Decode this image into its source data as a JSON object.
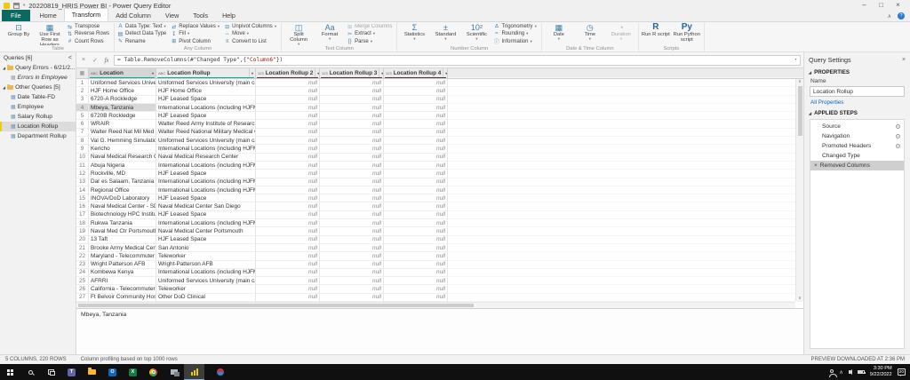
{
  "window": {
    "title": "20220819_HRIS Power BI - Power Query Editor"
  },
  "colors": {
    "accent_yellow": "#f2c80f",
    "file_tab_teal": "#0a6a62",
    "quality_valid": "#00b294",
    "quality_empty": "#5a3434",
    "link_blue": "#0a66c2",
    "string_red": "#a31515"
  },
  "ribbon": {
    "tabs": [
      {
        "label": "File",
        "style": "file"
      },
      {
        "label": "Home"
      },
      {
        "label": "Transform",
        "active": true
      },
      {
        "label": "Add Column"
      },
      {
        "label": "View"
      },
      {
        "label": "Tools"
      },
      {
        "label": "Help"
      }
    ],
    "groups": [
      {
        "label": "Table",
        "buttons": [
          {
            "label": "Group By",
            "icon": "group-by",
            "size": "big"
          },
          {
            "label": "Use First Row as Headers",
            "icon": "first-row-headers",
            "size": "big",
            "dropdown": true
          },
          {
            "label": "Transpose",
            "icon": "transpose"
          },
          {
            "label": "Reverse Rows",
            "icon": "reverse-rows"
          },
          {
            "label": "Count Rows",
            "icon": "count-rows"
          }
        ]
      },
      {
        "label": "Any Column",
        "buttons": [
          {
            "label": "Data Type: Text",
            "icon": "data-type",
            "dropdown": true
          },
          {
            "label": "Detect Data Type",
            "icon": "detect-data-type"
          },
          {
            "label": "Rename",
            "icon": "rename"
          },
          {
            "label": "Replace Values",
            "icon": "replace-values",
            "dropdown": true
          },
          {
            "label": "Fill",
            "icon": "fill",
            "dropdown": true
          },
          {
            "label": "Pivot Column",
            "icon": "pivot-column"
          },
          {
            "label": "Unpivot Columns",
            "icon": "unpivot-columns",
            "dropdown": true
          },
          {
            "label": "Move",
            "icon": "move",
            "dropdown": true
          },
          {
            "label": "Convert to List",
            "icon": "convert-to-list"
          }
        ]
      },
      {
        "label": "Text Column",
        "buttons": [
          {
            "label": "Split Column",
            "icon": "split-column",
            "size": "big",
            "dropdown": true
          },
          {
            "label": "Format",
            "icon": "format",
            "size": "big",
            "dropdown": true
          },
          {
            "label": "Merge Columns",
            "icon": "merge-columns",
            "disabled": true
          },
          {
            "label": "Extract",
            "icon": "extract",
            "dropdown": true
          },
          {
            "label": "Parse",
            "icon": "parse",
            "dropdown": true
          }
        ]
      },
      {
        "label": "Number Column",
        "buttons": [
          {
            "label": "Statistics",
            "icon": "statistics",
            "size": "big",
            "dropdown": true
          },
          {
            "label": "Standard",
            "icon": "standard",
            "size": "big",
            "dropdown": true
          },
          {
            "label": "Scientific",
            "icon": "scientific",
            "size": "big",
            "dropdown": true
          },
          {
            "label": "Trigonometry",
            "icon": "trigonometry",
            "dropdown": true
          },
          {
            "label": "Rounding",
            "icon": "rounding",
            "dropdown": true
          },
          {
            "label": "Information",
            "icon": "information",
            "dropdown": true
          }
        ]
      },
      {
        "label": "Date & Time Column",
        "buttons": [
          {
            "label": "Date",
            "icon": "date",
            "size": "big",
            "dropdown": true
          },
          {
            "label": "Time",
            "icon": "time",
            "size": "big",
            "dropdown": true
          },
          {
            "label": "Duration",
            "icon": "duration",
            "size": "big",
            "dropdown": true,
            "disabled": true
          }
        ]
      },
      {
        "label": "Scripts",
        "buttons": [
          {
            "label": "Run R script",
            "icon": "run-r",
            "size": "big"
          },
          {
            "label": "Run Python script",
            "icon": "run-python",
            "size": "big"
          }
        ]
      }
    ]
  },
  "formula_bar": {
    "fx_label": "fx",
    "parts": [
      {
        "text": "= Table.RemoveColumns(#\"Changed Type\",{",
        "c": "#3b3b3b"
      },
      {
        "text": "\"Column6\"",
        "c": "#a31515"
      },
      {
        "text": "})",
        "c": "#3b3b3b"
      }
    ]
  },
  "queries_panel": {
    "title": "Queries [6]",
    "collapse_icon": "<",
    "items": [
      {
        "label": "Query Errors - 6/21/2...",
        "type": "folder",
        "indent": 0
      },
      {
        "label": "Errors in Employee",
        "type": "error",
        "indent": 1,
        "italic": true
      },
      {
        "label": "Other Queries [5]",
        "type": "folder",
        "indent": 0
      },
      {
        "label": "Date Table-FD",
        "type": "table",
        "indent": 1
      },
      {
        "label": "Employee",
        "type": "table",
        "indent": 1
      },
      {
        "label": "Salary Rollup",
        "type": "table",
        "indent": 1
      },
      {
        "label": "Location Rollup",
        "type": "table",
        "indent": 1,
        "selected": true
      },
      {
        "label": "Department Rollup",
        "type": "table",
        "indent": 1
      }
    ]
  },
  "table": {
    "columns": [
      {
        "name": "Location",
        "type": "text",
        "quality": "valid",
        "selected": true
      },
      {
        "name": "Location Rollup",
        "type": "text",
        "quality": "valid"
      },
      {
        "name": "Location Rollup 2",
        "type": "any",
        "quality": "empty"
      },
      {
        "name": "Location Rollup 3",
        "type": "any",
        "quality": "empty"
      },
      {
        "name": "Location Rollup 4",
        "type": "any",
        "quality": "empty"
      }
    ],
    "null_display": "null",
    "selected_row": 4,
    "preview_value": "Mbeya, Tanzania",
    "rows": [
      {
        "n": 1,
        "location": "Uniformed Services University",
        "rollup": "Uniformed Services University (main campus)"
      },
      {
        "n": 2,
        "location": "HJF Home Office",
        "rollup": "HJF Home Office"
      },
      {
        "n": 3,
        "location": "6720-A Rockledge",
        "rollup": "HJF Leased Space"
      },
      {
        "n": 4,
        "location": "Mbeya, Tanzania",
        "rollup": "International Locations (including HJFMRI)"
      },
      {
        "n": 5,
        "location": "6720B Rockledge",
        "rollup": "HJF Leased Space"
      },
      {
        "n": 6,
        "location": "WRAIR",
        "rollup": "Walter Reed Army Institute of Research"
      },
      {
        "n": 7,
        "location": "Walter Reed Nat Mil Med Ctr",
        "rollup": "Walter Reed National Military Medical Center"
      },
      {
        "n": 8,
        "location": "Val G. Hemming Simulation Ctr",
        "rollup": "Uniformed Services University (main campus)"
      },
      {
        "n": 9,
        "location": "Kericho",
        "rollup": "International Locations (including HJFMRI)"
      },
      {
        "n": 10,
        "location": "Naval Medical Research Center",
        "rollup": "Naval Medical Research Center"
      },
      {
        "n": 11,
        "location": "Abuja Nigeria",
        "rollup": "International Locations (including HJFMRI)"
      },
      {
        "n": 12,
        "location": "Rockville, MD",
        "rollup": "HJF Leased Space"
      },
      {
        "n": 13,
        "location": "Dar es Salaam, Tanzania",
        "rollup": "International Locations (including HJFMRI)"
      },
      {
        "n": 14,
        "location": "Regional Office",
        "rollup": "International Locations (including HJFMRI)"
      },
      {
        "n": 15,
        "location": "INOVA/DoD Laboratory",
        "rollup": "HJF Leased Space"
      },
      {
        "n": 16,
        "location": "Naval Medical Center - SD",
        "rollup": "Naval Medical Center San Diego"
      },
      {
        "n": 17,
        "location": "Biotechnology HPC Institute",
        "rollup": "HJF Leased Space"
      },
      {
        "n": 18,
        "location": "Rukwa Tanzania",
        "rollup": "International Locations (including HJFMRI)"
      },
      {
        "n": 19,
        "location": "Naval Med Ctr Portsmouth VA",
        "rollup": "Naval Medical Center Portsmouth"
      },
      {
        "n": 20,
        "location": "13 Taft",
        "rollup": "HJF Leased Space"
      },
      {
        "n": 21,
        "location": "Brooke Army Medical Center",
        "rollup": "San Antonio"
      },
      {
        "n": 22,
        "location": "Maryland - Telecommuter",
        "rollup": "Teleworker"
      },
      {
        "n": 23,
        "location": "Wright Patterson AFB",
        "rollup": "Wright-Patterson AFB"
      },
      {
        "n": 24,
        "location": "Kombewa Kenya",
        "rollup": "International Locations (including HJFMRI)"
      },
      {
        "n": 25,
        "location": "AFRRI",
        "rollup": "Uniformed Services University (main campus)"
      },
      {
        "n": 26,
        "location": "California - Telecommuter",
        "rollup": "Teleworker"
      },
      {
        "n": 27,
        "location": "Ft Belvoir Community Hospital",
        "rollup": "Other DoD Clinical"
      }
    ]
  },
  "query_settings": {
    "title": "Query Settings",
    "properties_label": "PROPERTIES",
    "name_label": "Name",
    "name_value": "Location Rollup",
    "all_properties_label": "All Properties",
    "applied_steps_label": "APPLIED STEPS",
    "steps": [
      {
        "label": "Source",
        "gear": true
      },
      {
        "label": "Navigation",
        "gear": true
      },
      {
        "label": "Promoted Headers",
        "gear": true
      },
      {
        "label": "Changed Type"
      },
      {
        "label": "Removed Columns",
        "selected": true,
        "delete_icon": true
      }
    ]
  },
  "status_bar": {
    "left_primary": "5 COLUMNS, 220 ROWS",
    "left_secondary": "Column profiling based on top 1000 rows",
    "right": "PREVIEW DOWNLOADED AT 2:36 PM"
  },
  "taskbar": {
    "icons": [
      {
        "name": "start"
      },
      {
        "name": "search"
      },
      {
        "name": "task-view"
      },
      {
        "name": "teams"
      },
      {
        "name": "file-explorer"
      },
      {
        "name": "outlook"
      },
      {
        "name": "excel"
      },
      {
        "name": "chrome"
      },
      {
        "name": "snip"
      },
      {
        "name": "power-bi",
        "active": true
      },
      {
        "name": "meeting",
        "gap": true
      }
    ],
    "tray": {
      "time": "3:30 PM",
      "date": "9/22/2022",
      "badge_count": "20"
    }
  }
}
